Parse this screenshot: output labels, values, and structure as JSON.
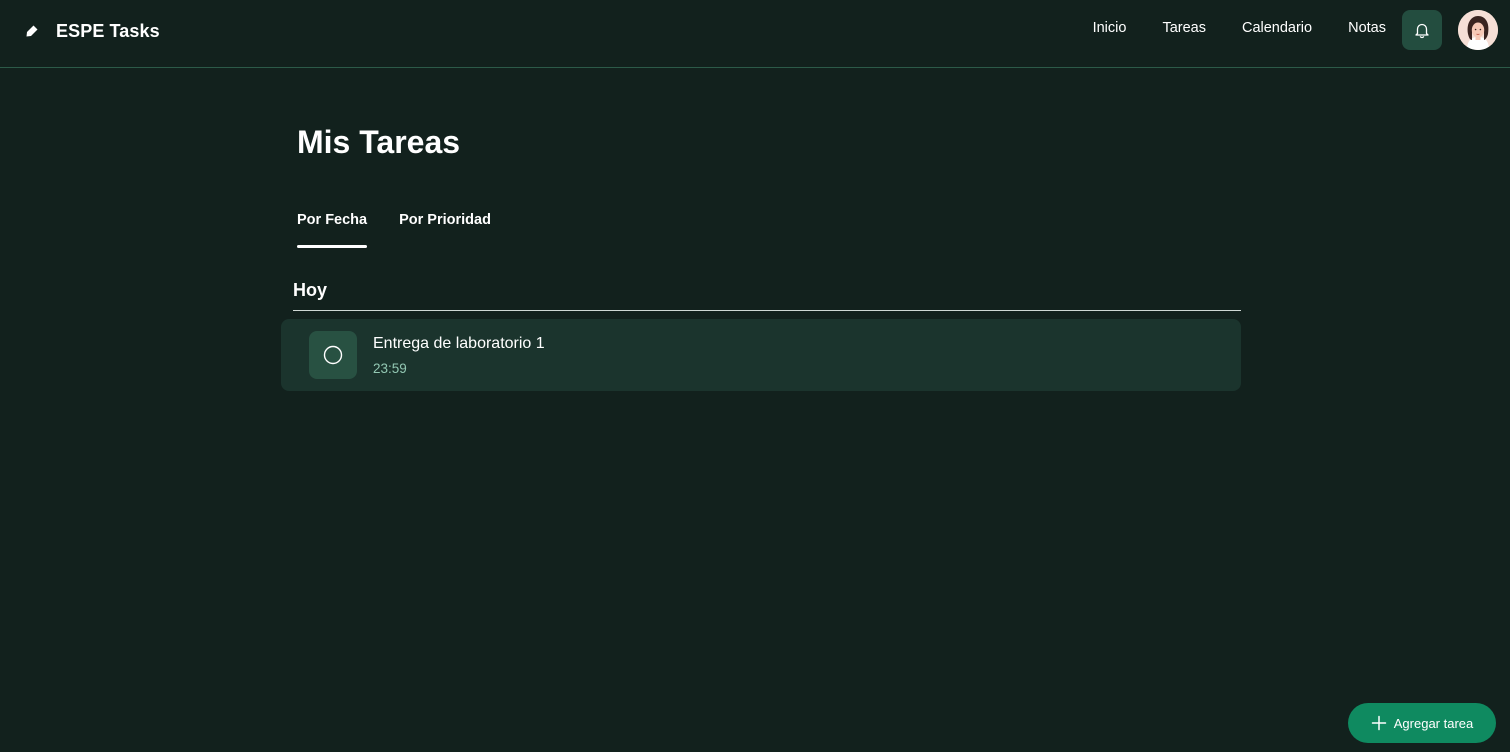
{
  "app": {
    "title": "ESPE Tasks",
    "logo_icon": "pen-nib-icon"
  },
  "nav": {
    "items": [
      {
        "label": "Inicio"
      },
      {
        "label": "Tareas"
      },
      {
        "label": "Calendario"
      },
      {
        "label": "Notas"
      }
    ],
    "notifications_icon": "bell-icon",
    "avatar_icon": "user-avatar"
  },
  "main": {
    "title": "Mis Tareas",
    "tabs": [
      {
        "label": "Por Fecha",
        "active": true
      },
      {
        "label": "Por Prioridad",
        "active": false
      }
    ],
    "sections": [
      {
        "title": "Hoy",
        "tasks": [
          {
            "name": "Entrega de laboratorio 1",
            "time": "23:59",
            "status_icon": "circle-outline-icon",
            "completed": false
          }
        ]
      }
    ]
  },
  "fab": {
    "label": "Agregar tarea",
    "icon": "plus-icon"
  },
  "colors": {
    "background": "#12211d",
    "surface": "#1b342d",
    "accent": "#0f8a60",
    "muted_text": "#93c8b3",
    "button_bg": "#234d3f"
  }
}
